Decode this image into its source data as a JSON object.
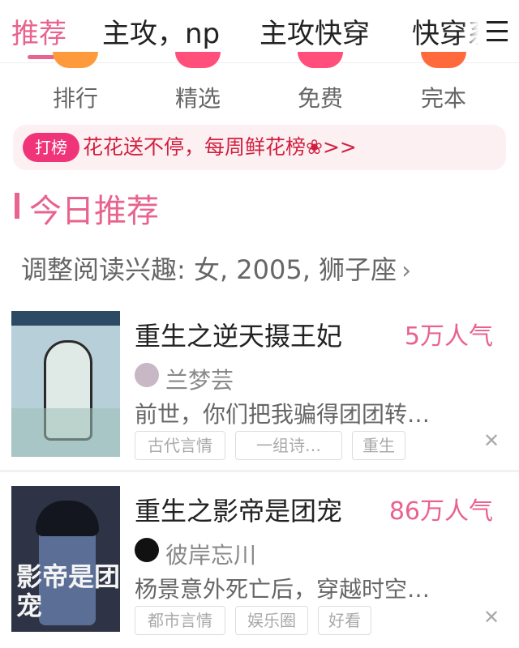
{
  "tabs": [
    {
      "label": "推荐"
    },
    {
      "label": "主攻，np"
    },
    {
      "label": "主攻快穿"
    },
    {
      "label": "快穿系"
    }
  ],
  "categories": [
    {
      "label": "排行",
      "icon": "ranking-icon",
      "color": "#ff9a3c"
    },
    {
      "label": "精选",
      "icon": "featured-icon",
      "color": "#ff4f7a"
    },
    {
      "label": "免费",
      "icon": "free-icon",
      "color": "#ff4f7a"
    },
    {
      "label": "完本",
      "icon": "completed-icon",
      "color": "#ff6a3d"
    }
  ],
  "banner": {
    "badge": "打榜",
    "text": "花花送不停，每周鲜花榜❀>>"
  },
  "section": {
    "title": "今日推荐"
  },
  "interest": {
    "text": "调整阅读兴趣: 女, 2005, 狮子座"
  },
  "books": [
    {
      "title": "重生之逆天摄王妃",
      "popularity": "5万人气",
      "author": "兰梦芸",
      "description": "前世，你们把我骗得团团转…",
      "tags": [
        "古代言情",
        "一组诗…",
        "重生"
      ],
      "cover_text": "",
      "cover_colors": {
        "bg": "#b7cfd8",
        "strip": "#2c4a63",
        "figure": "#dfeae6"
      }
    },
    {
      "title": "重生之影帝是团宠",
      "popularity": "86万人气",
      "author": "彼岸忘川",
      "description": "杨景意外死亡后，穿越时空…",
      "tags": [
        "都市言情",
        "娱乐圈",
        "好看"
      ],
      "cover_text": "影帝是团宠",
      "cover_colors": {
        "bg": "#2e3445",
        "strip": "#1d2230",
        "figure": "#5b6f96"
      }
    }
  ],
  "colors": {
    "accent": "#e8638e",
    "banner_red": "#d2203f",
    "badge": "#f0347a"
  }
}
